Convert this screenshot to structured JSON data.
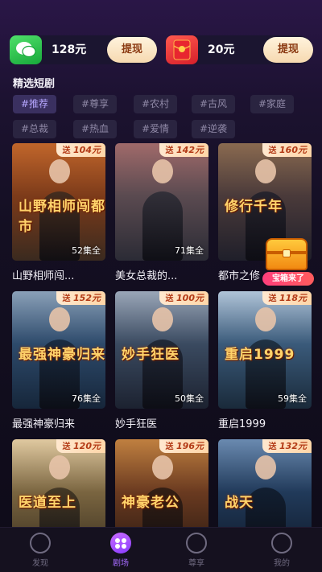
{
  "wallets": [
    {
      "icon": "wechat-icon",
      "amount": "128元",
      "button": "提现"
    },
    {
      "icon": "red-envelope-icon",
      "amount": "20元",
      "button": "提现"
    }
  ],
  "section": {
    "title": "精选短剧"
  },
  "tags": [
    "#推荐",
    "#尊享",
    "#农村",
    "#古风",
    "#家庭",
    "#总裁",
    "#热血",
    "#爱情",
    "#逆袭"
  ],
  "dramas": [
    {
      "title": "山野相师闯...",
      "poster_text": "山野相师闯都市",
      "badge_prefix": "送",
      "badge_value": "104元",
      "episodes": "52集全",
      "palette": [
        "#3a2a1f",
        "#7d3b1a",
        "#c1662b"
      ]
    },
    {
      "title": "美女总裁的...",
      "poster_text": "",
      "badge_prefix": "送",
      "badge_value": "142元",
      "episodes": "71集全",
      "palette": [
        "#2b2b35",
        "#5a4a50",
        "#a06a6a"
      ]
    },
    {
      "title": "都市之修",
      "poster_text": "修行千年",
      "badge_prefix": "送",
      "badge_value": "160元",
      "episodes": "",
      "palette": [
        "#1f1f2a",
        "#4a3a3a",
        "#8a6a50"
      ]
    },
    {
      "title": "最强神豪归来",
      "poster_text": "最强神豪归来",
      "badge_prefix": "送",
      "badge_value": "152元",
      "episodes": "76集全",
      "palette": [
        "#16263a",
        "#2d4a6b",
        "#8aa0b8"
      ]
    },
    {
      "title": "妙手狂医",
      "poster_text": "妙手狂医",
      "badge_prefix": "送",
      "badge_value": "100元",
      "episodes": "50集全",
      "palette": [
        "#1c2230",
        "#3a4a60",
        "#9aa6b8"
      ]
    },
    {
      "title": "重启1999",
      "poster_text": "重启1999",
      "badge_prefix": "送",
      "badge_value": "118元",
      "episodes": "59集全",
      "palette": [
        "#1a2a3a",
        "#3a5a7a",
        "#b0c4d8"
      ]
    },
    {
      "title": "医道至上",
      "poster_text": "医道至上",
      "badge_prefix": "送",
      "badge_value": "120元",
      "episodes": "",
      "palette": [
        "#3a3020",
        "#7a6540",
        "#e0c9a0"
      ]
    },
    {
      "title": "神豪老公",
      "poster_text": "神豪老公",
      "badge_prefix": "送",
      "badge_value": "196元",
      "episodes": "",
      "palette": [
        "#2a1a12",
        "#6a3a20",
        "#c08040"
      ]
    },
    {
      "title": "战天",
      "poster_text": "战天",
      "badge_prefix": "送",
      "badge_value": "132元",
      "episodes": "",
      "palette": [
        "#0f1a2a",
        "#213a5a",
        "#6a8ab0"
      ]
    }
  ],
  "treasure": {
    "label": "宝箱来了",
    "icon": "treasure-chest-icon"
  },
  "nav": [
    {
      "label": "发现",
      "icon": "discover-icon",
      "active": false
    },
    {
      "label": "剧场",
      "icon": "theater-icon",
      "active": true
    },
    {
      "label": "尊享",
      "icon": "premium-icon",
      "active": false
    },
    {
      "label": "我的",
      "icon": "profile-icon",
      "active": false
    }
  ],
  "colors": {
    "accent": "#a66bff",
    "badge_text": "#b33a16",
    "cashout_text": "#8b3a12"
  }
}
